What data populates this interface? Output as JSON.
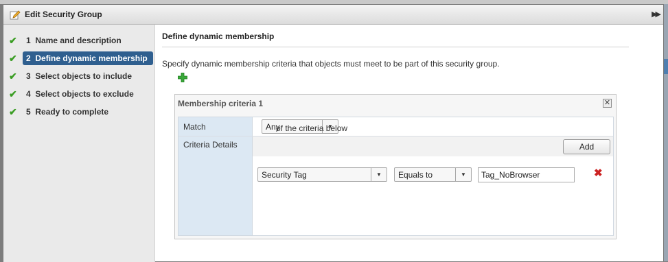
{
  "dialog": {
    "title": "Edit Security Group",
    "icons": {
      "title": "edit-pencil-icon",
      "expand": "double-chevron-right-icon"
    }
  },
  "steps": [
    {
      "number": "1",
      "label": "Name and description",
      "completed": true,
      "active": false
    },
    {
      "number": "2",
      "label": "Define dynamic membership",
      "completed": true,
      "active": true
    },
    {
      "number": "3",
      "label": "Select objects to include",
      "completed": true,
      "active": false
    },
    {
      "number": "4",
      "label": "Select objects to exclude",
      "completed": true,
      "active": false
    },
    {
      "number": "5",
      "label": "Ready to complete",
      "completed": true,
      "active": false
    }
  ],
  "main": {
    "section_title": "Define dynamic membership",
    "description": "Specify dynamic membership criteria that objects must meet to be part of this security group.",
    "add_icon": "green-plus-icon"
  },
  "criteria": {
    "title": "Membership criteria 1",
    "close_icon": "close-x-icon",
    "match_label": "Match",
    "match_value": "Any",
    "match_suffix": "of the criteria below",
    "details_label": "Criteria Details",
    "add_button": "Add",
    "row": {
      "attribute": "Security Tag",
      "operator": "Equals to",
      "value": "Tag_NoBrowser",
      "remove_icon": "red-x-remove-icon"
    }
  },
  "colors": {
    "active_step_bg": "#2f5f8f",
    "check": "#3a9d23",
    "label_column": "#dce8f3",
    "remove": "#cc2222"
  }
}
